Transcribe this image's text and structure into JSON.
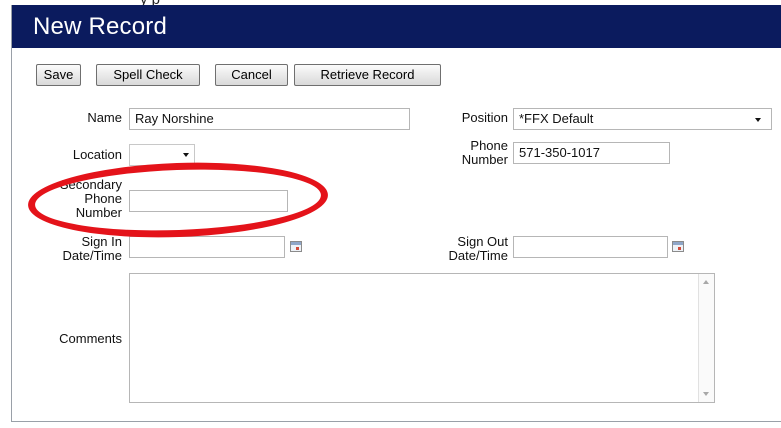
{
  "app": {
    "window_title": "New Record",
    "top_partial_text": "y p"
  },
  "toolbar": {
    "save_label": "Save",
    "spell_check_label": "Spell Check",
    "cancel_label": "Cancel",
    "retrieve_label": "Retrieve Record"
  },
  "form": {
    "name": {
      "label": "Name",
      "value": "Ray Norshine"
    },
    "position": {
      "label": "Position",
      "value": "*FFX Default"
    },
    "location": {
      "label": "Location",
      "value": ""
    },
    "phone": {
      "label_line1": "Phone",
      "label_line2": "Number",
      "value": "571-350-1017"
    },
    "secondary_phone": {
      "label_line1": "Secondary",
      "label_line2": "Phone",
      "label_line3": "Number",
      "value": ""
    },
    "sign_in": {
      "label_line1": "Sign In",
      "label_line2": "Date/Time",
      "value": ""
    },
    "sign_out": {
      "label_line1": "Sign Out",
      "label_line2": "Date/Time",
      "value": ""
    },
    "comments": {
      "label": "Comments",
      "value": ""
    }
  },
  "colors": {
    "titlebar": "#0b1b5e",
    "annotation": "#e4131a"
  },
  "icons": {
    "calendar": "calendar-icon",
    "dropdown": "chevron-down-icon"
  }
}
